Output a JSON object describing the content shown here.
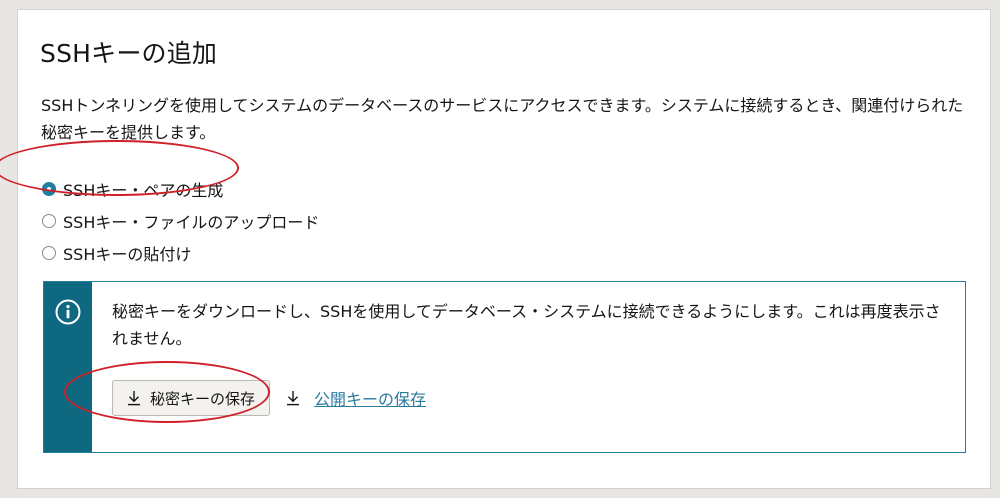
{
  "dialog": {
    "title": "SSHキーの追加",
    "description": "SSHトンネリングを使用してシステムのデータベースのサービスにアクセスできます。システムに接続するとき、関連付けられた秘密キーを提供します。"
  },
  "radio_options": [
    {
      "label": "SSHキー・ペアの生成",
      "checked": true
    },
    {
      "label": "SSHキー・ファイルのアップロード",
      "checked": false
    },
    {
      "label": "SSHキーの貼付け",
      "checked": false
    }
  ],
  "info": {
    "icon": "info-icon",
    "message": "秘密キーをダウンロードし、SSHを使用してデータベース・システムに接続できるようにします。これは再度表示されません。",
    "save_private_label": "秘密キーの保存",
    "save_public_label": "公開キーの保存"
  },
  "colors": {
    "accent": "#227e9e",
    "info_strip": "#0e6880",
    "link": "#2a7aa0",
    "annotation": "#d0202a"
  }
}
